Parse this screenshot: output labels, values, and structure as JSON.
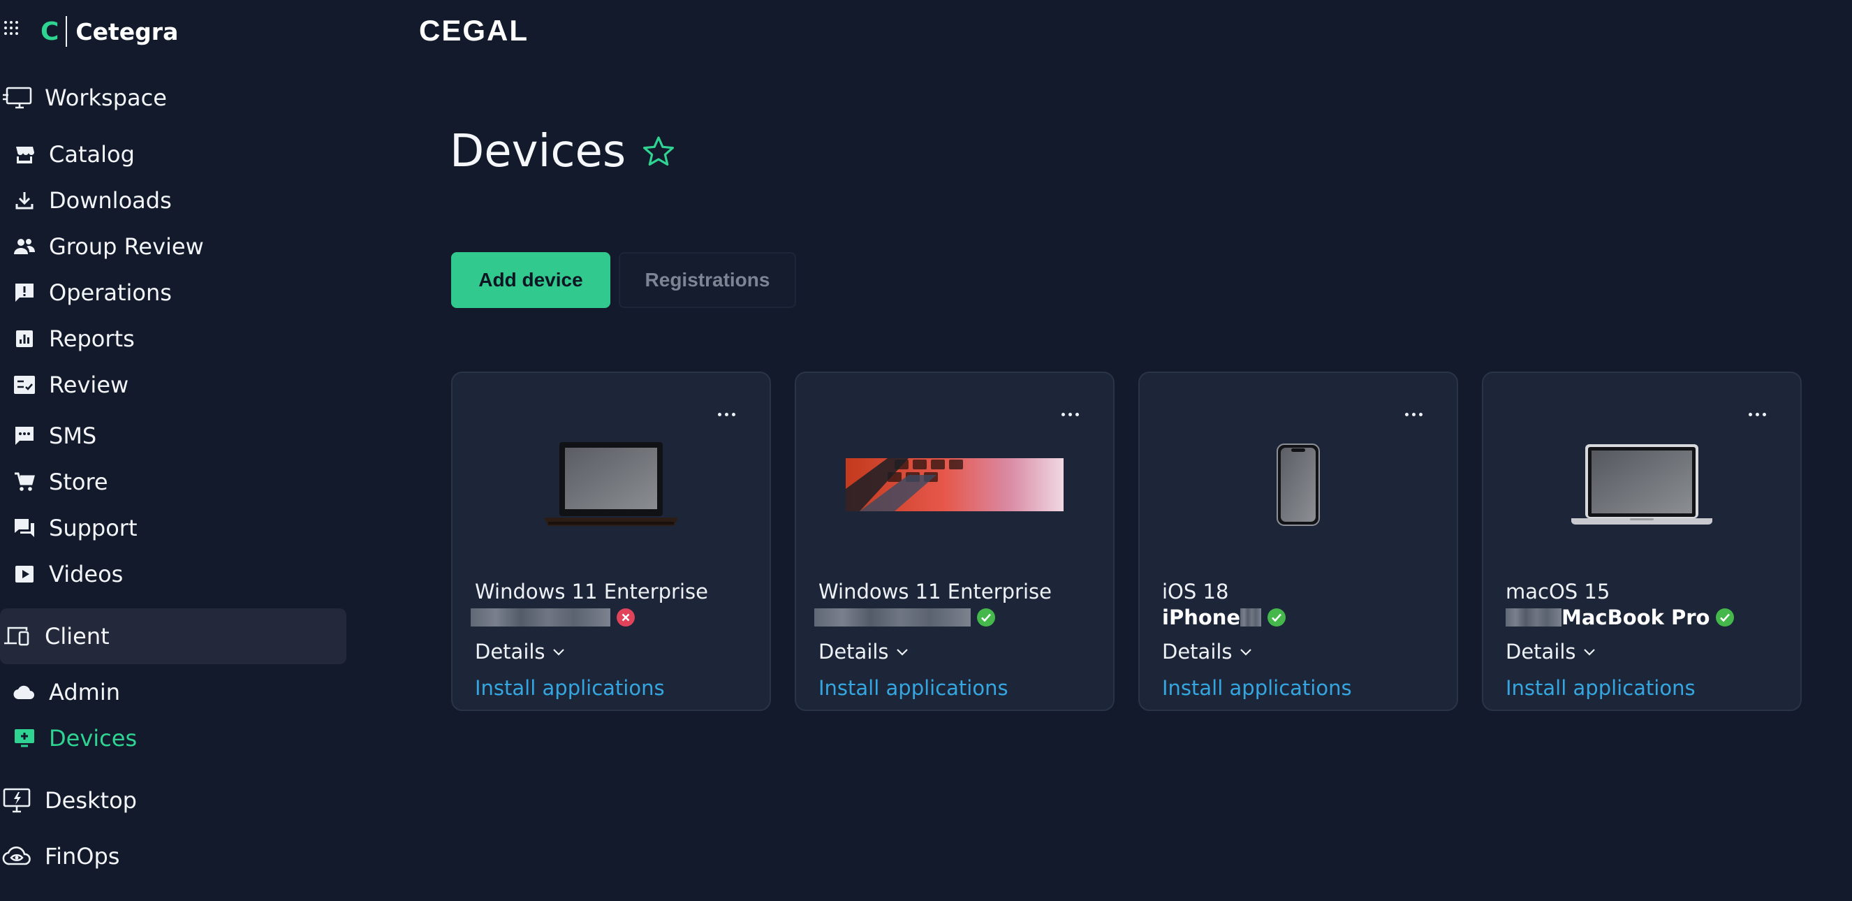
{
  "brand": {
    "letter": "C",
    "name": "Cetegra"
  },
  "nav": {
    "workspace": "Workspace",
    "catalog": "Catalog",
    "downloads": "Downloads",
    "group_review": "Group Review",
    "operations": "Operations",
    "reports": "Reports",
    "review": "Review",
    "sms": "SMS",
    "store": "Store",
    "support": "Support",
    "videos": "Videos",
    "client": "Client",
    "admin": "Admin",
    "devices": "Devices",
    "desktop": "Desktop",
    "finops": "FinOps"
  },
  "header": {
    "logo_text": "CEGAL"
  },
  "page": {
    "title": "Devices"
  },
  "actions": {
    "add_device": "Add device",
    "registrations": "Registrations"
  },
  "cards": [
    {
      "os": "Windows 11 Enterprise",
      "name_visible": "",
      "status": "error",
      "details": "Details",
      "install": "Install applications"
    },
    {
      "os": "Windows 11 Enterprise",
      "name_visible": "",
      "status": "ok",
      "details": "Details",
      "install": "Install applications"
    },
    {
      "os": "iOS 18",
      "name_visible": "iPhone",
      "status": "ok",
      "details": "Details",
      "install": "Install applications"
    },
    {
      "os": "macOS 15",
      "name_visible": "MacBook Pro",
      "status": "ok",
      "details": "Details",
      "install": "Install applications"
    }
  ],
  "colors": {
    "background": "#121a2b",
    "card": "#1d2638",
    "accent": "#2fd493",
    "button": "#31c98e",
    "link": "#35a6e0",
    "ok": "#44b84a",
    "error": "#e0435a"
  }
}
